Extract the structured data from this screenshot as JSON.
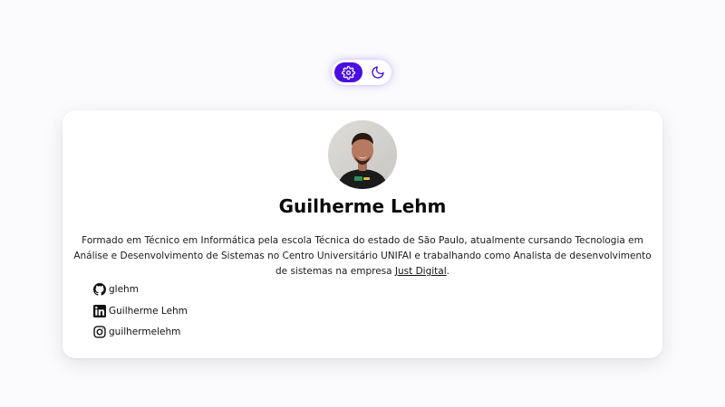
{
  "theme_toggle": {
    "buttons": [
      {
        "icon": "gear-icon",
        "active": true
      },
      {
        "icon": "moon-icon",
        "active": false
      }
    ],
    "accent_color": "#4a0fe0"
  },
  "profile": {
    "name": "Guilherme Lehm",
    "bio_text": "Formado em Técnico em Informática pela escola Técnica do estado de São Paulo, atualmente cursando Tecnologia em Análise e Desenvolvimento de Sistemas no Centro Universitário UNIFAI e trabalhando como Analista de desenvolvimento de sistemas na empresa ",
    "company_link": "Just Digital",
    "bio_end": "."
  },
  "socials": [
    {
      "icon": "github-icon",
      "label": "glehm"
    },
    {
      "icon": "linkedin-icon",
      "label": "Guilherme Lehm"
    },
    {
      "icon": "instagram-icon",
      "label": "guilhermelehm"
    }
  ]
}
